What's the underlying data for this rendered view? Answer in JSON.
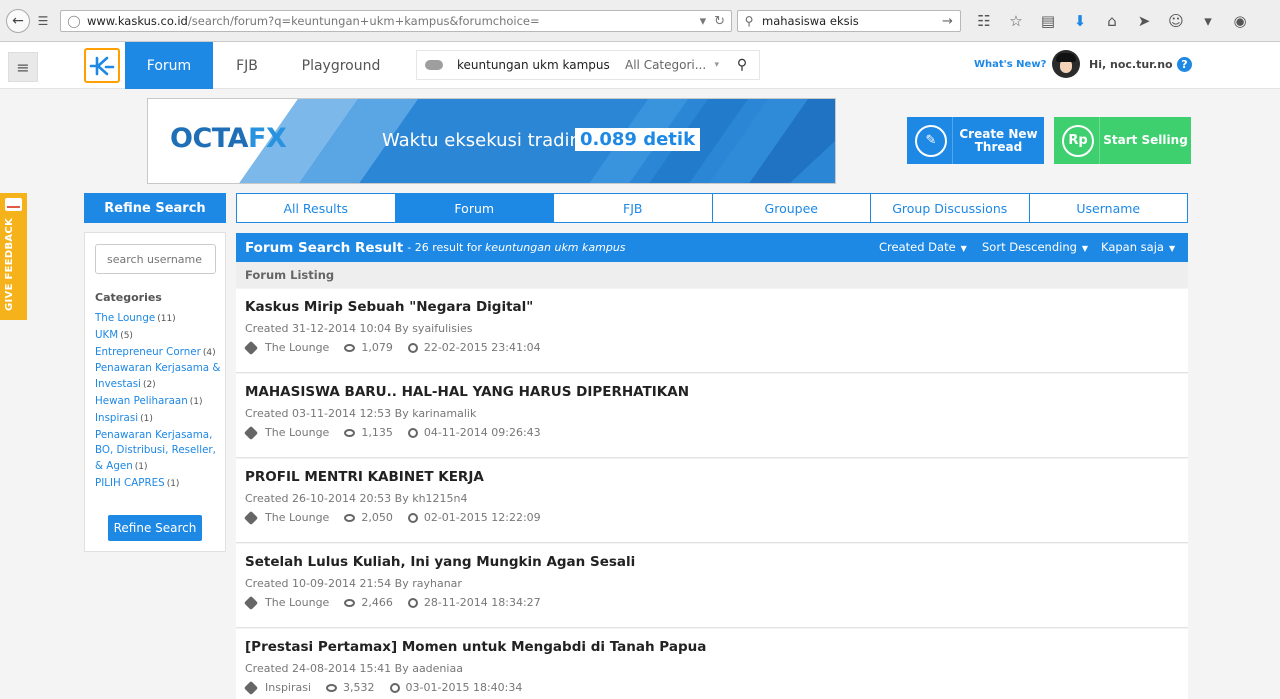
{
  "browser": {
    "url_prefix": "www.kaskus.co.id",
    "url_rest": "/search/forum?q=keuntungan+ukm+kampus&forumchoice=",
    "search_value": "mahasiswa eksis"
  },
  "header": {
    "nav_forum": "Forum",
    "nav_fjb": "FJB",
    "nav_playground": "Playground",
    "search_value": "keuntungan ukm kampus",
    "search_category": "All Categori...",
    "whats_new": "What's New?",
    "greeting": "Hi, noc.tur.no",
    "help": "?"
  },
  "feedback": {
    "label": "GIVE FEEDBACK"
  },
  "banner": {
    "logo_part1": "OCTA",
    "logo_part2": "FX",
    "text": "Waktu eksekusi trading:",
    "highlight": "0.089 detik"
  },
  "actions": {
    "create_thread_line1": "Create New",
    "create_thread_line2": "Thread",
    "start_selling": "Start Selling",
    "rp_symbol": "Rp"
  },
  "sidebar": {
    "title": "Refine Search",
    "username_placeholder": "search username",
    "categories_title": "Categories",
    "categories": [
      {
        "label": "The Lounge",
        "count": "(11)"
      },
      {
        "label": "UKM",
        "count": "(5)"
      },
      {
        "label": "Entrepreneur Corner",
        "count": "(4)"
      },
      {
        "label": "Penawaran Kerjasama & Investasi",
        "count": "(2)"
      },
      {
        "label": "Hewan Peliharaan",
        "count": "(1)"
      },
      {
        "label": "Inspirasi",
        "count": "(1)"
      },
      {
        "label": "Penawaran Kerjasama, BO, Distribusi, Reseller, & Agen",
        "count": "(1)"
      },
      {
        "label": "PILIH CAPRES",
        "count": "(1)"
      }
    ],
    "refine_button": "Refine Search"
  },
  "tabs": [
    {
      "label": "All Results",
      "active": false
    },
    {
      "label": "Forum",
      "active": true
    },
    {
      "label": "FJB",
      "active": false
    },
    {
      "label": "Groupee",
      "active": false
    },
    {
      "label": "Group Discussions",
      "active": false
    },
    {
      "label": "Username",
      "active": false
    }
  ],
  "results": {
    "title": "Forum Search Result",
    "count_text": "- 26 result for",
    "query": "keuntungan ukm kampus",
    "sort_date": "Created Date",
    "sort_order": "Sort Descending",
    "sort_when": "Kapan saja",
    "listing_label": "Forum Listing"
  },
  "threads": [
    {
      "title": "Kaskus Mirip Sebuah \"Negara Digital\"",
      "meta": "Created 31-12-2014 10:04 By syaifulisies",
      "category": "The Lounge",
      "views": "1,079",
      "last_post": "22-02-2015 23:41:04"
    },
    {
      "title": "MAHASISWA BARU.. HAL-HAL YANG HARUS DIPERHATIKAN",
      "meta": "Created 03-11-2014 12:53 By karinamalik",
      "category": "The Lounge",
      "views": "1,135",
      "last_post": "04-11-2014 09:26:43"
    },
    {
      "title": "PROFIL MENTRI KABINET KERJA",
      "meta": "Created 26-10-2014 20:53 By kh1215n4",
      "category": "The Lounge",
      "views": "2,050",
      "last_post": "02-01-2015 12:22:09"
    },
    {
      "title": "Setelah Lulus Kuliah, Ini yang Mungkin Agan Sesali",
      "meta": "Created 10-09-2014 21:54 By rayhanar",
      "category": "The Lounge",
      "views": "2,466",
      "last_post": "28-11-2014 18:34:27"
    },
    {
      "title": "[Prestasi Pertamax] Momen untuk Mengabdi di Tanah Papua",
      "meta": "Created 24-08-2014 15:41 By aadeniaa",
      "category": "Inspirasi",
      "views": "3,532",
      "last_post": "03-01-2015 18:40:34"
    }
  ]
}
